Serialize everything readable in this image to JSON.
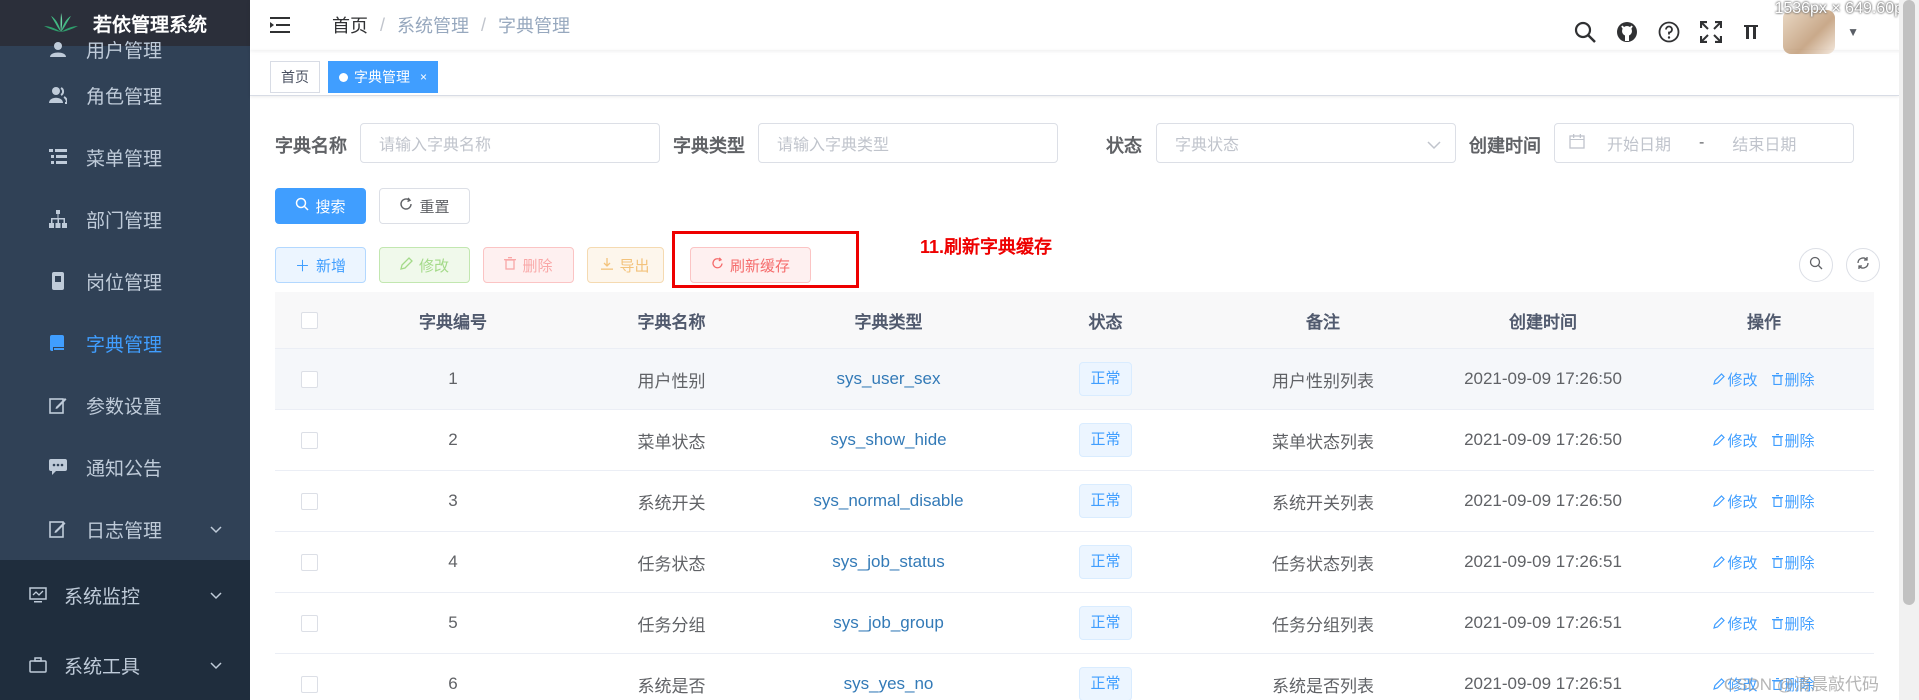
{
  "dimension_overlay": "1536px × 649.60px",
  "sidebar": {
    "logo_text": "若依管理系统",
    "partial_top_item": "用户管理",
    "items": [
      {
        "label": "角色管理",
        "icon": "peoples-icon"
      },
      {
        "label": "菜单管理",
        "icon": "tree-table-icon"
      },
      {
        "label": "部门管理",
        "icon": "tree-icon"
      },
      {
        "label": "岗位管理",
        "icon": "post-icon"
      },
      {
        "label": "字典管理",
        "icon": "dict-icon",
        "active": true
      },
      {
        "label": "参数设置",
        "icon": "edit-icon"
      },
      {
        "label": "通知公告",
        "icon": "message-icon"
      },
      {
        "label": "日志管理",
        "icon": "log-icon",
        "expandable": true
      }
    ],
    "sections": [
      {
        "label": "系统监控",
        "icon": "monitor-icon"
      },
      {
        "label": "系统工具",
        "icon": "tool-icon"
      }
    ]
  },
  "header": {
    "breadcrumb": [
      "首页",
      "系统管理",
      "字典管理"
    ]
  },
  "tags": {
    "home": "首页",
    "active": "字典管理",
    "close": "×"
  },
  "search_form": {
    "dict_name_label": "字典名称",
    "dict_name_placeholder": "请输入字典名称",
    "dict_type_label": "字典类型",
    "dict_type_placeholder": "请输入字典类型",
    "status_label": "状态",
    "status_placeholder": "字典状态",
    "create_time_label": "创建时间",
    "start_placeholder": "开始日期",
    "range_sep": "-",
    "end_placeholder": "结束日期",
    "search_btn": "搜索",
    "reset_btn": "重置"
  },
  "toolbar": {
    "add": "新增",
    "edit": "修改",
    "delete": "删除",
    "export": "导出",
    "refresh_cache": "刷新缓存"
  },
  "annotation": "11.刷新字典缓存",
  "table": {
    "headers": [
      "字典编号",
      "字典名称",
      "字典类型",
      "状态",
      "备注",
      "创建时间",
      "操作"
    ],
    "rows": [
      {
        "id": "1",
        "name": "用户性别",
        "type": "sys_user_sex",
        "status": "正常",
        "remark": "用户性别列表",
        "time": "2021-09-09 17:26:50"
      },
      {
        "id": "2",
        "name": "菜单状态",
        "type": "sys_show_hide",
        "status": "正常",
        "remark": "菜单状态列表",
        "time": "2021-09-09 17:26:50"
      },
      {
        "id": "3",
        "name": "系统开关",
        "type": "sys_normal_disable",
        "status": "正常",
        "remark": "系统开关列表",
        "time": "2021-09-09 17:26:50"
      },
      {
        "id": "4",
        "name": "任务状态",
        "type": "sys_job_status",
        "status": "正常",
        "remark": "任务状态列表",
        "time": "2021-09-09 17:26:51"
      },
      {
        "id": "5",
        "name": "任务分组",
        "type": "sys_job_group",
        "status": "正常",
        "remark": "任务分组列表",
        "time": "2021-09-09 17:26:51"
      },
      {
        "id": "6",
        "name": "系统是否",
        "type": "sys_yes_no",
        "status": "正常",
        "remark": "系统是否列表",
        "time": "2021-09-09 17:26:51"
      }
    ],
    "op_edit": "修改",
    "op_delete": "删除"
  },
  "watermark": "CSDN @清晨敲代码",
  "colors": {
    "sidebar_bg": "#304156",
    "primary": "#409eff",
    "annotation_red": "#e00000"
  }
}
